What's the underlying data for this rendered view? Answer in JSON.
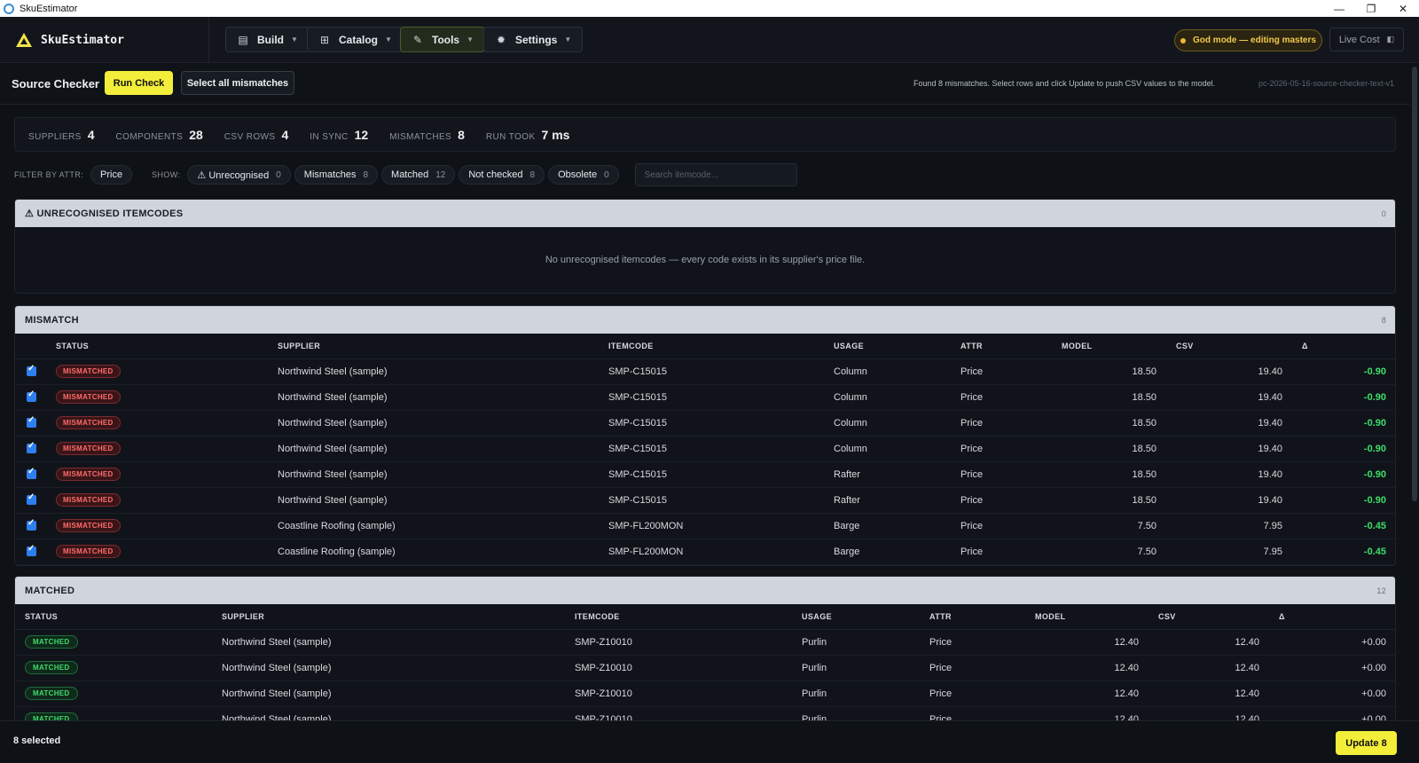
{
  "window": {
    "title": "SkuEstimator",
    "minimize": "—",
    "maximize": "❐",
    "close": "✕"
  },
  "header": {
    "brand": "SkuEstimator",
    "nav": [
      {
        "label": "Build",
        "icon": "document-icon"
      },
      {
        "label": "Catalog",
        "icon": "grid-icon"
      },
      {
        "label": "Tools",
        "icon": "wrench-icon"
      },
      {
        "label": "Settings",
        "icon": "gear-icon"
      }
    ],
    "god_mode": "God mode — editing masters",
    "live_cost": "Live Cost"
  },
  "toolbar": {
    "title": "Source Checker",
    "run_check": "Run Check",
    "select_all": "Select all mismatches",
    "status": "Found 8 mismatches. Select rows and click Update to push CSV values to the model.",
    "version": "pc-2026-05-16-source-checker-text-v1"
  },
  "stats": [
    {
      "label": "SUPPLIERS",
      "value": "4"
    },
    {
      "label": "COMPONENTS",
      "value": "28"
    },
    {
      "label": "CSV ROWS",
      "value": "4"
    },
    {
      "label": "IN SYNC",
      "value": "12"
    },
    {
      "label": "MISMATCHES",
      "value": "8"
    },
    {
      "label": "RUN TOOK",
      "value": "7 ms"
    }
  ],
  "filters": {
    "attr_label": "FILTER BY ATTR:",
    "attr_value": "Price",
    "show_label": "SHOW:",
    "chips": [
      {
        "label": "⚠ Unrecognised",
        "count": "0"
      },
      {
        "label": "Mismatches",
        "count": "8"
      },
      {
        "label": "Matched",
        "count": "12"
      },
      {
        "label": "Not checked",
        "count": "8"
      },
      {
        "label": "Obsolete",
        "count": "0"
      }
    ],
    "search_placeholder": "Search itemcode..."
  },
  "unrecognised": {
    "title": "⚠ UNRECOGNISED ITEMCODES",
    "count": "0",
    "empty": "No unrecognised itemcodes — every code exists in its supplier's price file."
  },
  "mismatch": {
    "title": "MISMATCH",
    "count": "8",
    "columns": [
      "STATUS",
      "SUPPLIER",
      "ITEMCODE",
      "USAGE",
      "ATTR",
      "MODEL",
      "CSV",
      "Δ"
    ],
    "rows": [
      {
        "status": "MISMATCHED",
        "supplier": "Northwind Steel (sample)",
        "itemcode": "SMP-C15015",
        "usage": "Column",
        "attr": "Price",
        "model": "18.50",
        "csv": "19.40",
        "delta": "-0.90"
      },
      {
        "status": "MISMATCHED",
        "supplier": "Northwind Steel (sample)",
        "itemcode": "SMP-C15015",
        "usage": "Column",
        "attr": "Price",
        "model": "18.50",
        "csv": "19.40",
        "delta": "-0.90"
      },
      {
        "status": "MISMATCHED",
        "supplier": "Northwind Steel (sample)",
        "itemcode": "SMP-C15015",
        "usage": "Column",
        "attr": "Price",
        "model": "18.50",
        "csv": "19.40",
        "delta": "-0.90"
      },
      {
        "status": "MISMATCHED",
        "supplier": "Northwind Steel (sample)",
        "itemcode": "SMP-C15015",
        "usage": "Column",
        "attr": "Price",
        "model": "18.50",
        "csv": "19.40",
        "delta": "-0.90"
      },
      {
        "status": "MISMATCHED",
        "supplier": "Northwind Steel (sample)",
        "itemcode": "SMP-C15015",
        "usage": "Rafter",
        "attr": "Price",
        "model": "18.50",
        "csv": "19.40",
        "delta": "-0.90"
      },
      {
        "status": "MISMATCHED",
        "supplier": "Northwind Steel (sample)",
        "itemcode": "SMP-C15015",
        "usage": "Rafter",
        "attr": "Price",
        "model": "18.50",
        "csv": "19.40",
        "delta": "-0.90"
      },
      {
        "status": "MISMATCHED",
        "supplier": "Coastline Roofing (sample)",
        "itemcode": "SMP-FL200MON",
        "usage": "Barge",
        "attr": "Price",
        "model": "7.50",
        "csv": "7.95",
        "delta": "-0.45"
      },
      {
        "status": "MISMATCHED",
        "supplier": "Coastline Roofing (sample)",
        "itemcode": "SMP-FL200MON",
        "usage": "Barge",
        "attr": "Price",
        "model": "7.50",
        "csv": "7.95",
        "delta": "-0.45"
      }
    ]
  },
  "matched": {
    "title": "MATCHED",
    "count": "12",
    "columns": [
      "STATUS",
      "SUPPLIER",
      "ITEMCODE",
      "USAGE",
      "ATTR",
      "MODEL",
      "CSV",
      "Δ"
    ],
    "rows": [
      {
        "status": "MATCHED",
        "supplier": "Northwind Steel (sample)",
        "itemcode": "SMP-Z10010",
        "usage": "Purlin",
        "attr": "Price",
        "model": "12.40",
        "csv": "12.40",
        "delta": "+0.00"
      },
      {
        "status": "MATCHED",
        "supplier": "Northwind Steel (sample)",
        "itemcode": "SMP-Z10010",
        "usage": "Purlin",
        "attr": "Price",
        "model": "12.40",
        "csv": "12.40",
        "delta": "+0.00"
      },
      {
        "status": "MATCHED",
        "supplier": "Northwind Steel (sample)",
        "itemcode": "SMP-Z10010",
        "usage": "Purlin",
        "attr": "Price",
        "model": "12.40",
        "csv": "12.40",
        "delta": "+0.00"
      },
      {
        "status": "MATCHED",
        "supplier": "Northwind Steel (sample)",
        "itemcode": "SMP-Z10010",
        "usage": "Purlin",
        "attr": "Price",
        "model": "12.40",
        "csv": "12.40",
        "delta": "+0.00"
      }
    ]
  },
  "footer": {
    "selected": "8 selected",
    "update": "Update 8"
  },
  "colors": {
    "accent": "#f2ee3a",
    "mismatch": "#ff6b6b",
    "matched": "#3ddc6a",
    "god_mode": "#f2c94c"
  }
}
